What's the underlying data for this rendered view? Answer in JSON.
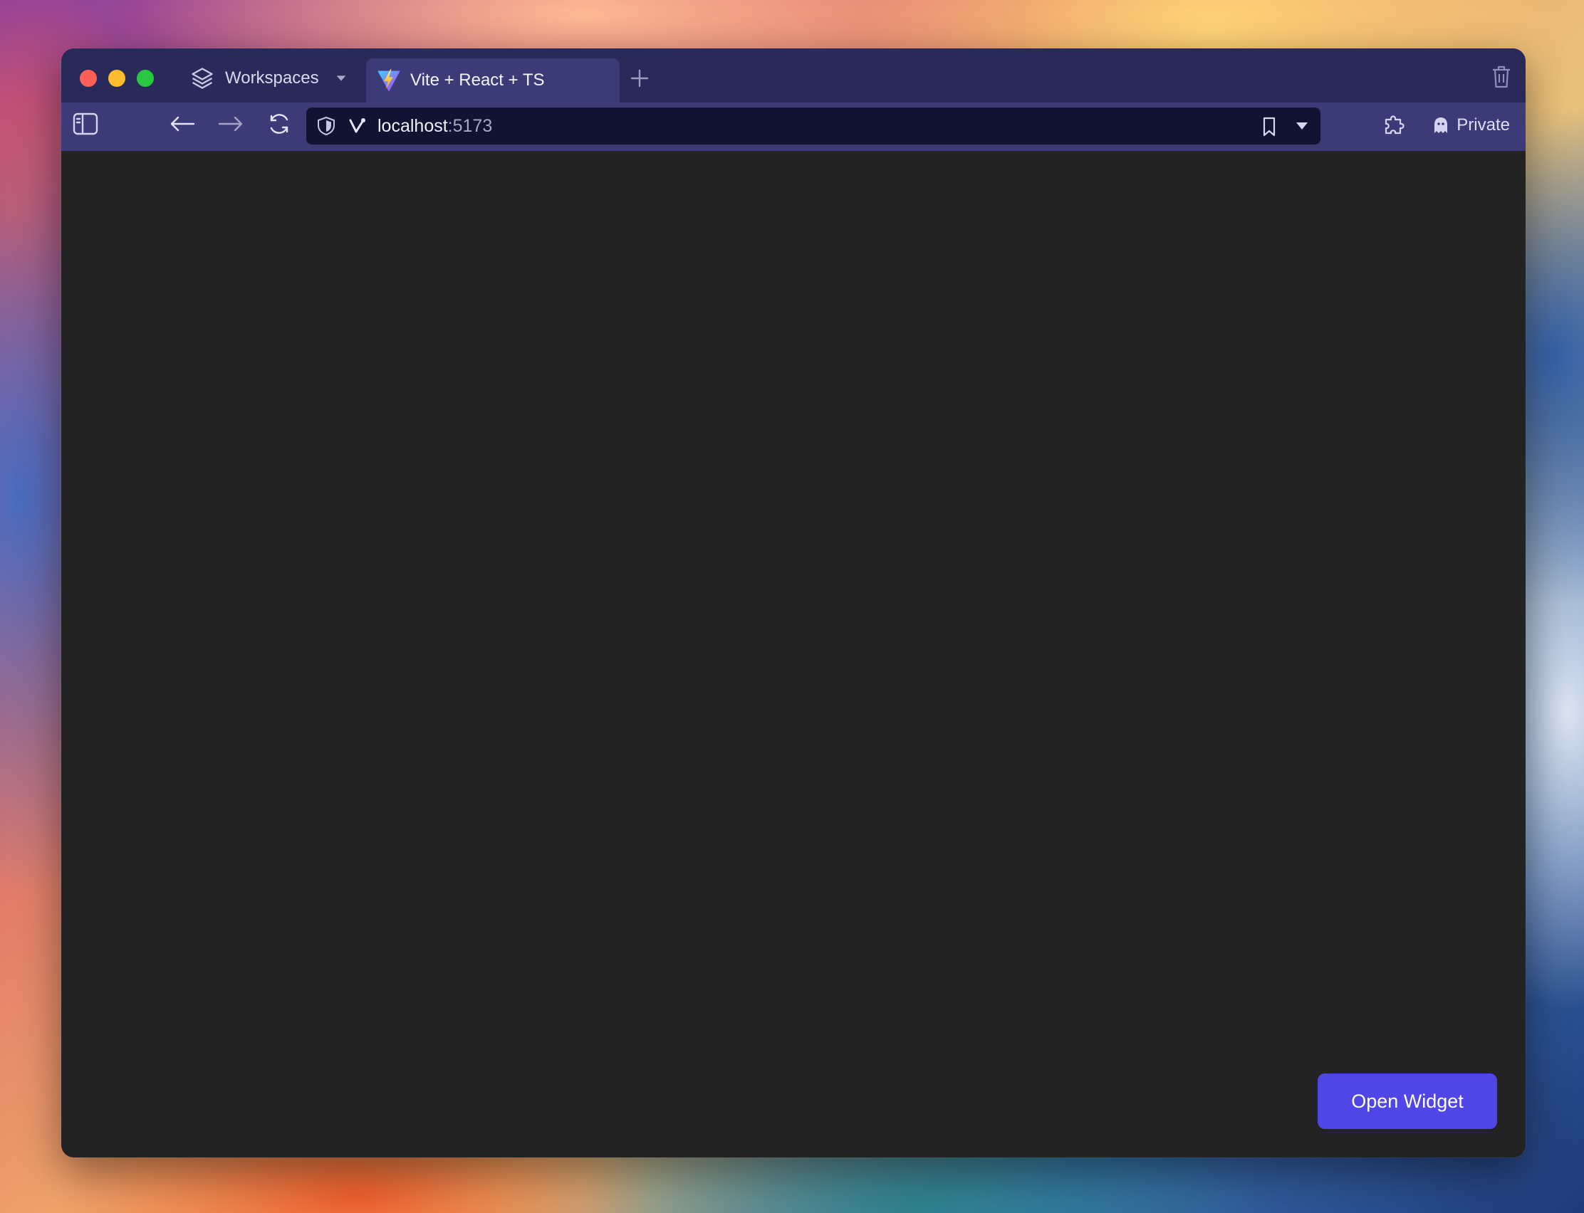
{
  "browser": {
    "workspaces_label": "Workspaces",
    "active_tab_title": "Vite + React + TS",
    "url_host": "localhost",
    "url_port": ":5173",
    "private_label": "Private"
  },
  "page": {
    "open_widget_label": "Open Widget"
  },
  "colors": {
    "tabbar_bg": "#2a2a5a",
    "toolbar_bg": "#3b3b78",
    "urlbar_bg": "#111333",
    "content_bg": "#232323",
    "button_accent": "#4f46e5"
  },
  "icons": [
    "layers-icon",
    "chevron-down-icon",
    "vite-favicon-icon",
    "plus-icon",
    "trash-icon",
    "sidebar-toggle-icon",
    "back-arrow-icon",
    "forward-arrow-icon",
    "reload-icon",
    "shield-icon",
    "vivaldi-logo-icon",
    "bookmark-icon",
    "extensions-icon",
    "ghost-icon"
  ]
}
